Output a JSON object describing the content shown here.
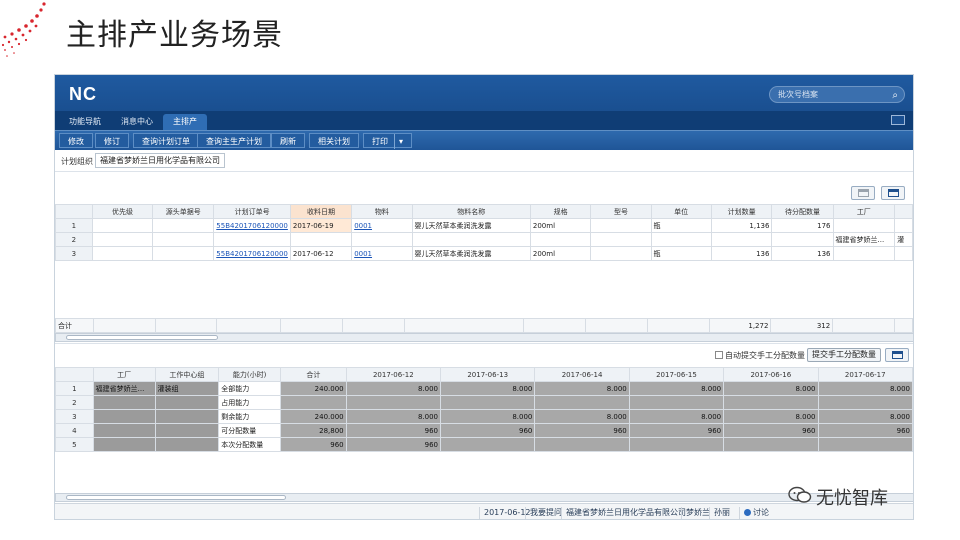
{
  "slide": {
    "title": "主排产业务场景",
    "watermark": "无忧智库"
  },
  "app": {
    "logo": "NC",
    "search_placeholder": "批次号档案",
    "tabs": [
      {
        "label": "功能导航",
        "active": false
      },
      {
        "label": "消息中心",
        "active": false
      },
      {
        "label": "主排产",
        "active": true
      }
    ],
    "toolbar": [
      "修改",
      "修订",
      "查询计划订单",
      "查询主生产计划",
      "刷新",
      "相关计划",
      "打印"
    ],
    "org_label": "计划组织",
    "org_value": "福建省梦娇兰日用化学品有限公司"
  },
  "grid1": {
    "headers": [
      "",
      "优先级",
      "源头单据号",
      "计划订单号",
      "收料日期",
      "物料",
      "物料名称",
      "规格",
      "型号",
      "单位",
      "计划数量",
      "待分配数量",
      "工厂"
    ],
    "rows": [
      [
        "1",
        "",
        "",
        "55B4201706120000",
        "2017-06-19",
        "0001",
        "婴儿天然草本柔润洗发露",
        "200ml",
        "",
        "瓶",
        "1,136",
        "176",
        ""
      ],
      [
        "2",
        "",
        "",
        "",
        "",
        "",
        "",
        "",
        "",
        "",
        "",
        "",
        "福建省梦娇兰..."
      ],
      [
        "3",
        "",
        "",
        "55B4201706120000",
        "2017-06-12",
        "0001",
        "婴儿天然草本柔润洗发露",
        "200ml",
        "",
        "瓶",
        "136",
        "136",
        ""
      ]
    ],
    "extra_cell_row2": "灌",
    "total_label": "合计",
    "total_plan": "1,272",
    "total_pending": "312"
  },
  "midbar": {
    "auto_submit_label": "自动提交手工分配数量",
    "submit_button": "提交手工分配数量"
  },
  "grid2": {
    "headers": [
      "",
      "工厂",
      "工作中心组",
      "能力(小时)",
      "合计",
      "2017-06-12",
      "2017-06-13",
      "2017-06-14",
      "2017-06-15",
      "2017-06-16",
      "2017-06-17"
    ],
    "rows": [
      [
        "1",
        "福建省梦娇兰...",
        "灌装组",
        "全部能力",
        "240.000",
        "8.000",
        "8.000",
        "8.000",
        "8.000",
        "8.000",
        "8.000"
      ],
      [
        "2",
        "",
        "",
        "占用能力",
        "",
        "",
        "",
        "",
        "",
        "",
        ""
      ],
      [
        "3",
        "",
        "",
        "剩余能力",
        "240.000",
        "8.000",
        "8.000",
        "8.000",
        "8.000",
        "8.000",
        "8.000"
      ],
      [
        "4",
        "",
        "",
        "可分配数量",
        "28,800",
        "960",
        "960",
        "960",
        "960",
        "960",
        "960"
      ],
      [
        "5",
        "",
        "",
        "本次分配数量",
        "960",
        "960",
        "",
        "",
        "",
        "",
        ""
      ]
    ]
  },
  "status": {
    "date": "2017-06-12",
    "link1": "我要提问",
    "company": "福建省梦娇兰日用化学品有限公司",
    "user": "梦娇兰",
    "user2": "孙丽",
    "discuss": "讨论"
  }
}
